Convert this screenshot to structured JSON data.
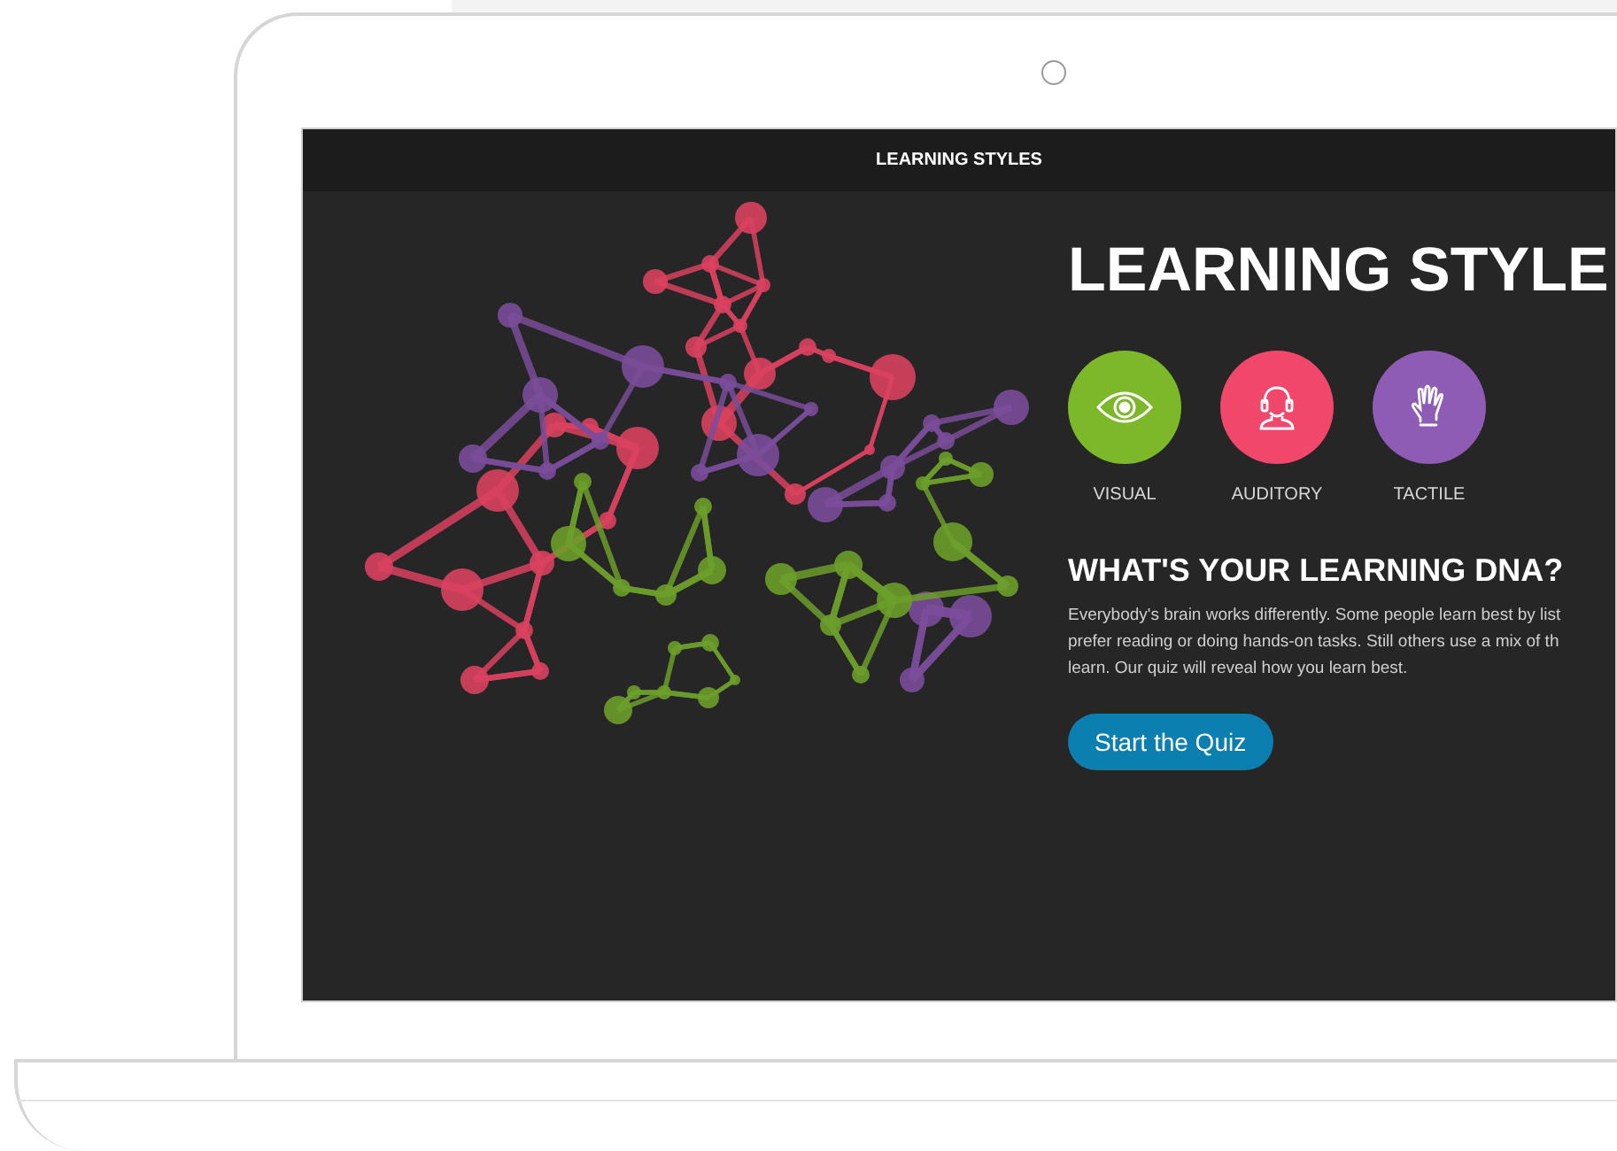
{
  "top_bar": {
    "title": "LEARNING STYLES"
  },
  "hero": {
    "title": "LEARNING STYLE"
  },
  "styles": [
    {
      "label": "VISUAL",
      "kind": "eye",
      "color": "#7cb82a"
    },
    {
      "label": "AUDITORY",
      "kind": "headphones",
      "color": "#f0476b"
    },
    {
      "label": "TACTILE",
      "kind": "hand",
      "color": "#8e5bb5"
    }
  ],
  "section": {
    "heading": "WHAT'S YOUR LEARNING DNA?",
    "lines": [
      "Everybody's brain works differently. Some people learn best by list",
      "prefer reading or doing hands-on tasks. Still others use a mix of th",
      "learn. Our quiz will reveal how you learn best."
    ]
  },
  "button": {
    "label": "Start the Quiz"
  }
}
